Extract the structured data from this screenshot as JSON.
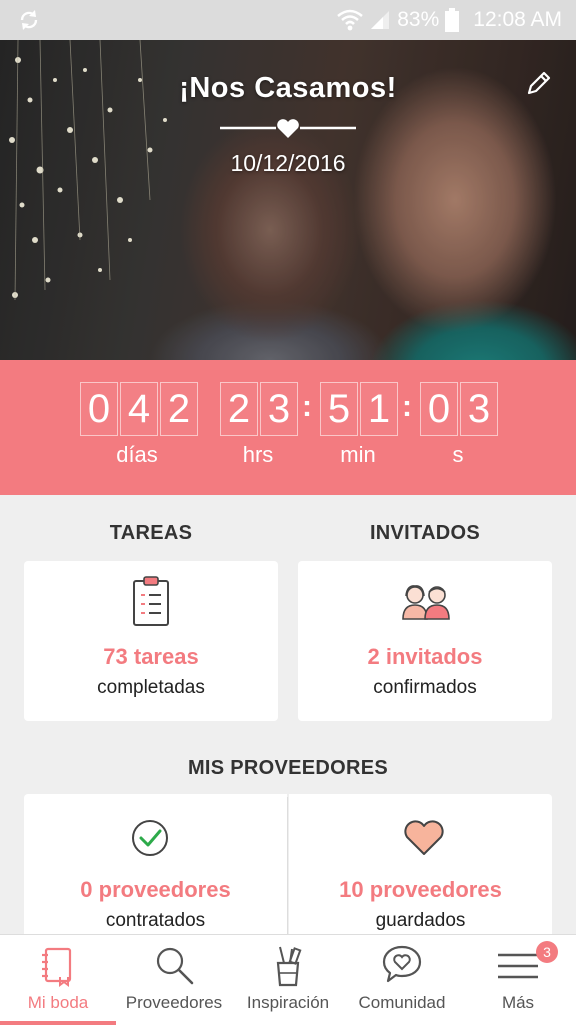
{
  "status_bar": {
    "battery": "83%",
    "time": "12:08 AM"
  },
  "hero": {
    "title": "¡Nos Casamos!",
    "date": "10/12/2016"
  },
  "countdown": {
    "days": [
      "0",
      "4",
      "2"
    ],
    "hours": [
      "2",
      "3"
    ],
    "minutes": [
      "5",
      "1"
    ],
    "seconds": [
      "0",
      "3"
    ],
    "labels": {
      "days": "días",
      "hours": "hrs",
      "minutes": "min",
      "seconds": "s"
    }
  },
  "tasks": {
    "section": "TAREAS",
    "count": "73 tareas",
    "sub": "completadas"
  },
  "guests": {
    "section": "INVITADOS",
    "count": "2 invitados",
    "sub": "confirmados"
  },
  "vendors": {
    "section": "MIS PROVEEDORES",
    "hired": {
      "count": "0 proveedores",
      "sub": "contratados"
    },
    "saved": {
      "count": "10 proveedores",
      "sub": "guardados"
    }
  },
  "nav": {
    "items": [
      {
        "label": "Mi boda",
        "icon": "notebook-icon"
      },
      {
        "label": "Proveedores",
        "icon": "search-icon"
      },
      {
        "label": "Inspiración",
        "icon": "pencil-cup-icon"
      },
      {
        "label": "Comunidad",
        "icon": "chat-heart-icon"
      },
      {
        "label": "Más",
        "icon": "menu-icon"
      }
    ],
    "badge": "3"
  },
  "colors": {
    "accent": "#f37b80",
    "background": "#efefef"
  }
}
